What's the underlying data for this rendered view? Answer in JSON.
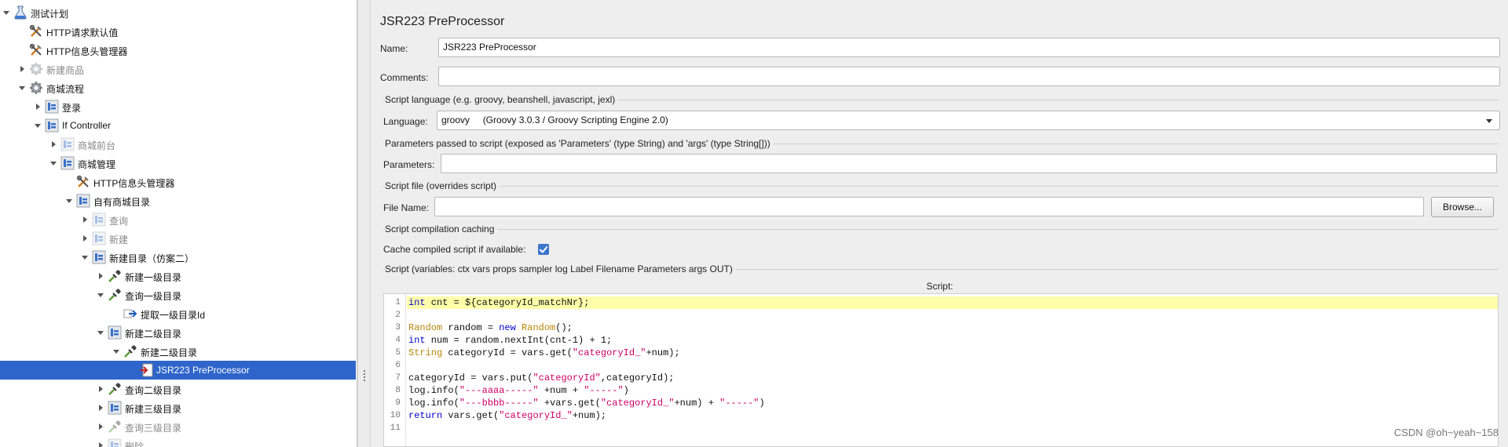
{
  "tree": {
    "items": [
      {
        "label": "测试计划",
        "depth": 0,
        "state": "expanded",
        "icon": "test-plan-flask-icon",
        "disabled": false
      },
      {
        "label": "HTTP请求默认值",
        "depth": 1,
        "state": "leaf",
        "icon": "config-tools-icon",
        "disabled": false
      },
      {
        "label": "HTTP信息头管理器",
        "depth": 1,
        "state": "leaf",
        "icon": "config-tools-icon",
        "disabled": false
      },
      {
        "label": "新建商品",
        "depth": 1,
        "state": "collapsed",
        "icon": "thread-group-gear-icon",
        "disabled": true
      },
      {
        "label": "商城流程",
        "depth": 1,
        "state": "expanded",
        "icon": "thread-group-gear-icon",
        "disabled": false
      },
      {
        "label": "登录",
        "depth": 2,
        "state": "collapsed",
        "icon": "controller-icon",
        "disabled": false
      },
      {
        "label": "If Controller",
        "depth": 2,
        "state": "expanded",
        "icon": "controller-icon",
        "disabled": false
      },
      {
        "label": "商城前台",
        "depth": 3,
        "state": "collapsed",
        "icon": "controller-icon",
        "disabled": true
      },
      {
        "label": "商城管理",
        "depth": 3,
        "state": "expanded",
        "icon": "controller-icon",
        "disabled": false
      },
      {
        "label": "HTTP信息头管理器",
        "depth": 4,
        "state": "leaf",
        "icon": "config-tools-icon",
        "disabled": false
      },
      {
        "label": "自有商城目录",
        "depth": 4,
        "state": "expanded",
        "icon": "controller-icon",
        "disabled": false
      },
      {
        "label": "查询",
        "depth": 5,
        "state": "collapsed",
        "icon": "controller-icon",
        "disabled": true
      },
      {
        "label": "新建",
        "depth": 5,
        "state": "collapsed",
        "icon": "controller-icon",
        "disabled": true
      },
      {
        "label": "新建目录（仿案二）",
        "depth": 5,
        "state": "expanded",
        "icon": "controller-icon",
        "disabled": false
      },
      {
        "label": "新建一级目录",
        "depth": 6,
        "state": "collapsed",
        "icon": "sampler-pipette-icon",
        "disabled": false
      },
      {
        "label": "查询一级目录",
        "depth": 6,
        "state": "expanded",
        "icon": "sampler-pipette-icon",
        "disabled": false
      },
      {
        "label": "提取一级目录Id",
        "depth": 7,
        "state": "leaf",
        "icon": "post-processor-arrow-icon",
        "disabled": false
      },
      {
        "label": "新建二级目录",
        "depth": 6,
        "state": "expanded",
        "icon": "controller-icon",
        "disabled": false
      },
      {
        "label": "新建二级目录",
        "depth": 7,
        "state": "expanded",
        "icon": "sampler-pipette-icon",
        "disabled": false
      },
      {
        "label": "JSR223 PreProcessor",
        "depth": 8,
        "state": "leaf",
        "icon": "pre-processor-script-icon",
        "disabled": false,
        "selected": true
      },
      {
        "label": "查询二级目录",
        "depth": 6,
        "state": "collapsed",
        "icon": "sampler-pipette-icon",
        "disabled": false
      },
      {
        "label": "新建三级目录",
        "depth": 6,
        "state": "collapsed",
        "icon": "controller-icon",
        "disabled": false
      },
      {
        "label": "查询三级目录",
        "depth": 6,
        "state": "collapsed",
        "icon": "sampler-pipette-icon",
        "disabled": true
      },
      {
        "label": "删除",
        "depth": 6,
        "state": "collapsed",
        "icon": "controller-icon",
        "disabled": true
      }
    ]
  },
  "panel": {
    "title": "JSR223 PreProcessor",
    "name_label": "Name:",
    "name_value": "JSR223 PreProcessor",
    "comments_label": "Comments:",
    "comments_value": "",
    "script_language_section": "Script language (e.g. groovy, beanshell, javascript, jexl)",
    "language_label": "Language:",
    "language_value": "groovy     (Groovy 3.0.3 / Groovy Scripting Engine 2.0)",
    "parameters_section": "Parameters passed to script (exposed as 'Parameters' (type String) and 'args' (type String[]))",
    "parameters_label": "Parameters:",
    "parameters_value": "",
    "script_file_section": "Script file (overrides script)",
    "file_name_label": "File Name:",
    "file_name_value": "",
    "browse_label": "Browse...",
    "caching_section": "Script compilation caching",
    "cache_label": "Cache compiled script if available:",
    "cache_checked": true,
    "script_section": "Script (variables: ctx vars props sampler log Label Filename Parameters args OUT)",
    "script_heading": "Script:"
  },
  "editor": {
    "current_line": 1,
    "lines": [
      "int cnt = ${categoryId_matchNr};",
      "",
      "Random random = new Random();",
      "int num = random.nextInt(cnt-1) + 1;",
      "String categoryId = vars.get(\"categoryId_\"+num);",
      "",
      "categoryId = vars.put(\"categoryId\",categoryId);",
      "log.info(\"---aaaa-----\" +num + \"-----\")",
      "log.info(\"---bbbb-----\" +vars.get(\"categoryId_\"+num) + \"-----\")",
      "return vars.get(\"categoryId_\"+num);",
      ""
    ]
  },
  "watermark": "CSDN @oh~yeah~158",
  "colors": {
    "selection": "#2f65ca",
    "current_line": "#ffffaa",
    "keyword": "#0000cc",
    "type": "#b8860b",
    "string": "#cc0066",
    "checkbox": "#3d74cc"
  }
}
